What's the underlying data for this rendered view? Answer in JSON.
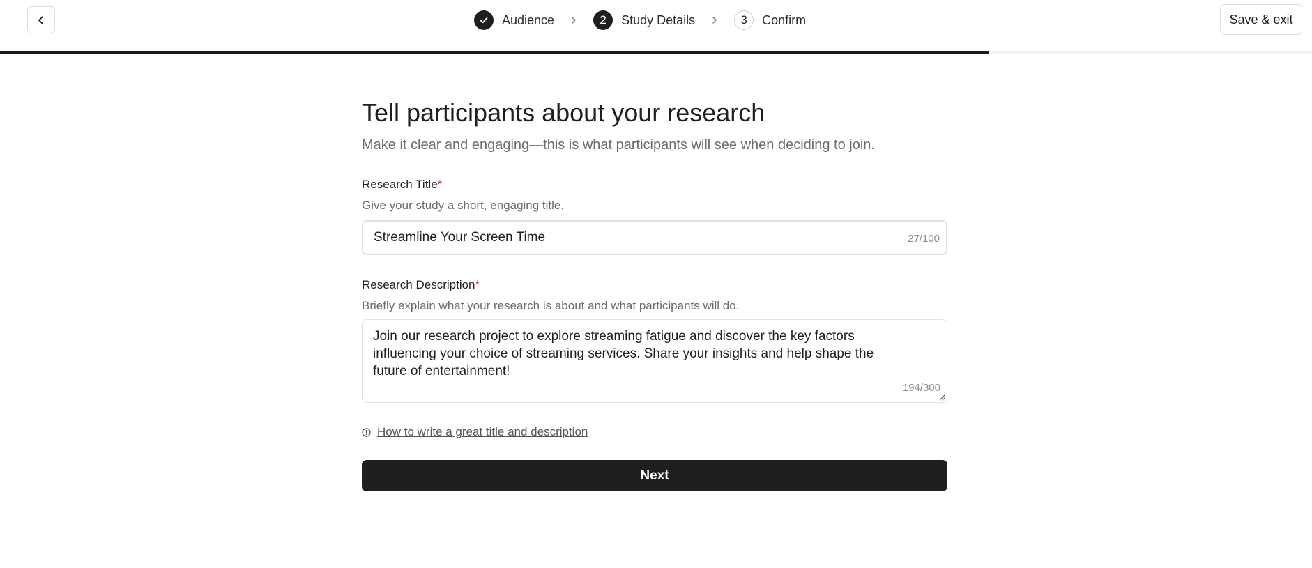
{
  "header": {
    "back_icon": "chevron-left-icon",
    "steps": [
      {
        "indicator": "",
        "label": "Audience",
        "state": "done",
        "icon": "check-icon"
      },
      {
        "indicator": "2",
        "label": "Study Details",
        "state": "active"
      },
      {
        "indicator": "3",
        "label": "Confirm",
        "state": "pending"
      }
    ],
    "save_exit_label": "Save & exit",
    "progress_percent": 75.4
  },
  "main": {
    "title": "Tell participants about your research",
    "subtitle": "Make it clear and engaging—this is what participants will see when deciding to join.",
    "title_field": {
      "label": "Research Title",
      "required_mark": "*",
      "hint": "Give your study a short, engaging title.",
      "value": "Streamline Your Screen Time",
      "counter": "27/100"
    },
    "description_field": {
      "label": "Research Description",
      "required_mark": "*",
      "hint": "Briefly explain what your research is about and what participants will do.",
      "value": "Join our research project to explore streaming fatigue and discover the key factors influencing your choice of streaming services. Share your insights and help shape the future of entertainment!",
      "counter": "194/300"
    },
    "help_icon": "info-circle-icon",
    "help_link": "How to write a great title and description",
    "next_label": "Next"
  },
  "colors": {
    "primary": "#1f1f1f",
    "required": "#d32f2f",
    "muted_text": "#6b6b6b",
    "border": "#e2e2e2"
  }
}
